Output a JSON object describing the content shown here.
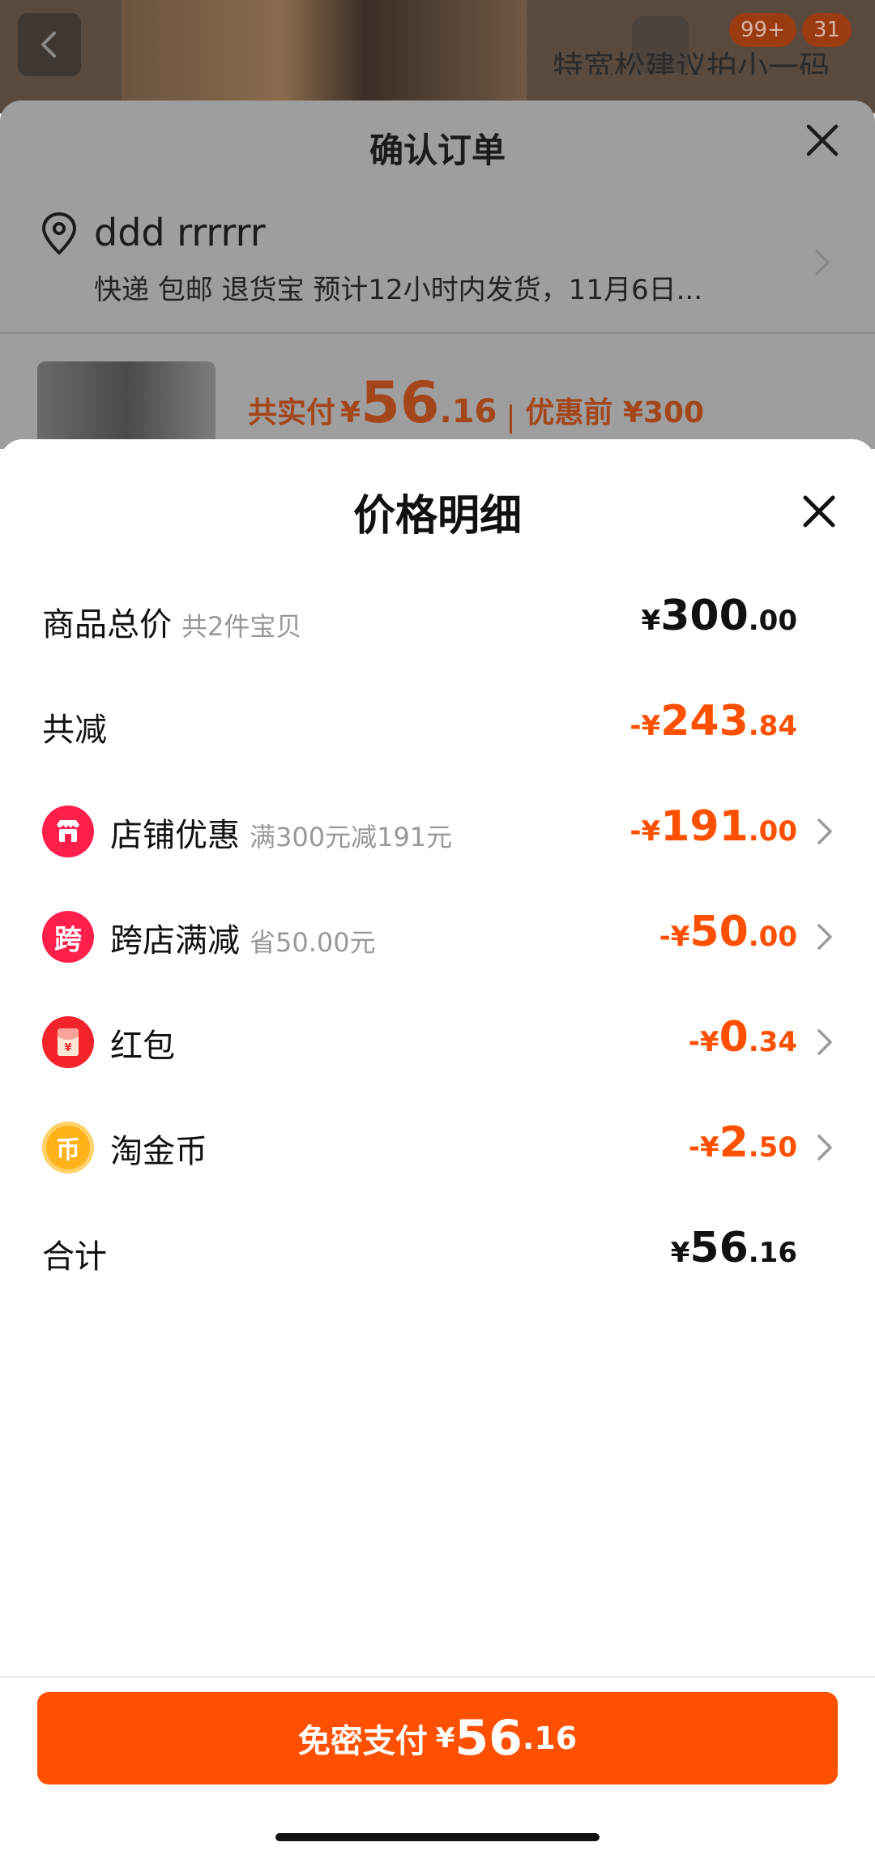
{
  "background": {
    "top_hint": "特宽松建议拍小一码",
    "badges": [
      "99+",
      "31"
    ],
    "order_title": "确认订单",
    "address_name": "ddd rrrrrr",
    "address_detail": "快递 包邮 退货宝 预计12小时内发货，11月6日...",
    "pay_label": "共实付",
    "pay_symbol": "¥",
    "pay_int": "56",
    "pay_dec": ".16",
    "before_label": "优惠前 ¥300"
  },
  "sheet": {
    "title": "价格明细",
    "rows": [
      {
        "label": "商品总价",
        "note": "共2件宝贝",
        "sign": "",
        "symbol": "¥",
        "int": "300",
        "dec": ".00",
        "color": "#111111"
      },
      {
        "label": "共减",
        "note": "",
        "sign": "-",
        "symbol": "¥",
        "int": "243",
        "dec": ".84",
        "color": "#ff5000"
      },
      {
        "label": "店铺优惠",
        "note": "满300元减191元",
        "sign": "-",
        "symbol": "¥",
        "int": "191",
        "dec": ".00",
        "color": "#ff5000",
        "icon": "store-icon",
        "icon_bg": "#ff1f4b"
      },
      {
        "label": "跨店满减",
        "note": "省50.00元",
        "sign": "-",
        "symbol": "¥",
        "int": "50",
        "dec": ".00",
        "color": "#ff5000",
        "icon": "cross-store-icon",
        "icon_text": "跨",
        "icon_bg": "#ff1f4b"
      },
      {
        "label": "红包",
        "note": "",
        "sign": "-",
        "symbol": "¥",
        "int": "0",
        "dec": ".34",
        "color": "#ff5000",
        "icon": "red-packet-icon",
        "icon_bg": "#f3232b"
      },
      {
        "label": "淘金币",
        "note": "",
        "sign": "-",
        "symbol": "¥",
        "int": "2",
        "dec": ".50",
        "color": "#ff5000",
        "icon": "taojinbi-coin-icon",
        "icon_text": "币",
        "icon_bg": "#ffb21a"
      },
      {
        "label": "合计",
        "note": "",
        "sign": "",
        "symbol": "¥",
        "int": "56",
        "dec": ".16",
        "color": "#111111"
      }
    ]
  },
  "footer": {
    "pay_button_label": "免密支付",
    "symbol": "¥",
    "int": "56",
    "dec": ".16",
    "accent_color": "#ff5000"
  }
}
